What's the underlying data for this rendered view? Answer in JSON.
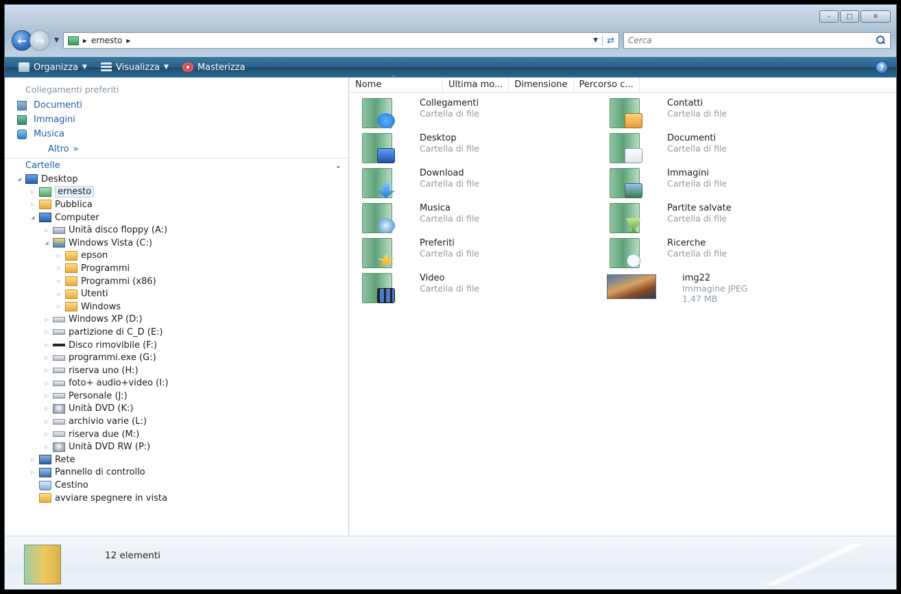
{
  "address": {
    "crumbs": [
      "ernesto"
    ],
    "search_placeholder": "Cerca"
  },
  "toolbar": {
    "organize": "Organizza",
    "view": "Visualizza",
    "burn": "Masterizza"
  },
  "favorites": {
    "title": "Collegamenti preferiti",
    "items": [
      "Documenti",
      "Immagini",
      "Musica"
    ],
    "more": "Altro"
  },
  "folders": {
    "title": "Cartelle",
    "tree": [
      {
        "label": "Desktop",
        "icon": "desktop-icon",
        "level": 0
      },
      {
        "label": "ernesto",
        "icon": "user-folder-icon",
        "level": 1,
        "selected": true
      },
      {
        "label": "Pubblica",
        "icon": "folder-icon",
        "level": 1
      },
      {
        "label": "Computer",
        "icon": "computer-icon",
        "level": 1
      },
      {
        "label": "Unità disco floppy (A:)",
        "icon": "floppy-drive-icon",
        "level": 2
      },
      {
        "label": "Windows Vista (C:)",
        "icon": "system-drive-icon",
        "level": 2
      },
      {
        "label": "epson",
        "icon": "folder-icon",
        "level": 3
      },
      {
        "label": "Programmi",
        "icon": "folder-icon",
        "level": 3
      },
      {
        "label": "Programmi (x86)",
        "icon": "folder-icon",
        "level": 3
      },
      {
        "label": "Utenti",
        "icon": "folder-icon",
        "level": 3
      },
      {
        "label": "Windows",
        "icon": "folder-icon",
        "level": 3
      },
      {
        "label": "Windows XP (D:)",
        "icon": "hard-drive-icon",
        "level": 2
      },
      {
        "label": "partizione di  C_D (E:)",
        "icon": "hard-drive-icon",
        "level": 2
      },
      {
        "label": "Disco rimovibile (F:)",
        "icon": "removable-drive-icon",
        "level": 2
      },
      {
        "label": "programmi.exe (G:)",
        "icon": "hard-drive-icon",
        "level": 2
      },
      {
        "label": "riserva  uno (H:)",
        "icon": "hard-drive-icon",
        "level": 2
      },
      {
        "label": "foto+ audio+video (I:)",
        "icon": "hard-drive-icon",
        "level": 2
      },
      {
        "label": "Personale (J:)",
        "icon": "hard-drive-icon",
        "level": 2
      },
      {
        "label": "Unità DVD (K:)",
        "icon": "dvd-drive-icon",
        "level": 2
      },
      {
        "label": "archivio varie (L:)",
        "icon": "hard-drive-icon",
        "level": 2
      },
      {
        "label": "riserva due (M:)",
        "icon": "hard-drive-icon",
        "level": 2
      },
      {
        "label": "Unità DVD RW (P:)",
        "icon": "dvd-drive-icon",
        "level": 2
      },
      {
        "label": "Rete",
        "icon": "network-icon",
        "level": 1
      },
      {
        "label": "Pannello di controllo",
        "icon": "control-panel-icon",
        "level": 1
      },
      {
        "label": "Cestino",
        "icon": "recycle-bin-icon",
        "level": 1
      },
      {
        "label": "avviare spegnere in vista",
        "icon": "folder-icon",
        "level": 1
      }
    ]
  },
  "columns": [
    "Nome",
    "Ultima mo...",
    "Dimensione",
    "Percorso c..."
  ],
  "files": [
    {
      "name": "Collegamenti",
      "sub": "Cartella di file",
      "icon": "links-folder-icon"
    },
    {
      "name": "Contatti",
      "sub": "Cartella di file",
      "icon": "contacts-folder-icon"
    },
    {
      "name": "Desktop",
      "sub": "Cartella di file",
      "icon": "desktop-folder-icon"
    },
    {
      "name": "Documenti",
      "sub": "Cartella di file",
      "icon": "documents-folder-icon"
    },
    {
      "name": "Download",
      "sub": "Cartella di file",
      "icon": "downloads-folder-icon"
    },
    {
      "name": "Immagini",
      "sub": "Cartella di file",
      "icon": "pictures-folder-icon"
    },
    {
      "name": "Musica",
      "sub": "Cartella di file",
      "icon": "music-folder-icon"
    },
    {
      "name": "Partite salvate",
      "sub": "Cartella di file",
      "icon": "saved-games-folder-icon"
    },
    {
      "name": "Preferiti",
      "sub": "Cartella di file",
      "icon": "favorites-folder-icon"
    },
    {
      "name": "Ricerche",
      "sub": "Cartella di file",
      "icon": "searches-folder-icon"
    },
    {
      "name": "Video",
      "sub": "Cartella di file",
      "icon": "videos-folder-icon"
    },
    {
      "name": "img22",
      "sub": "Immagine JPEG",
      "sub2": "1,47 MB",
      "icon": "jpeg-thumbnail"
    }
  ],
  "details": {
    "count": "12 elementi"
  }
}
